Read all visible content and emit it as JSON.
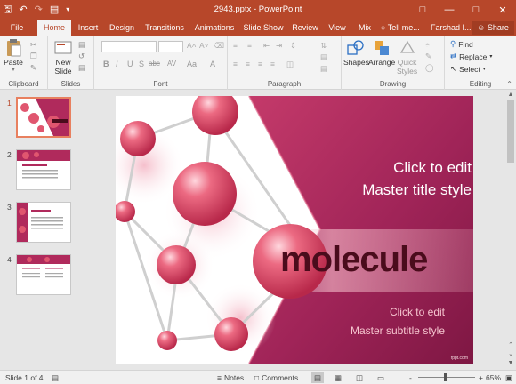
{
  "titlebar": {
    "doc_title": "2943.pptx - PowerPoint",
    "qat": [
      "save-icon",
      "undo-icon",
      "redo-icon",
      "start-icon",
      "customize-icon"
    ]
  },
  "tabs": [
    "File",
    "Home",
    "Insert",
    "Design",
    "Transitions",
    "Animations",
    "Slide Show",
    "Review",
    "View",
    "Mix"
  ],
  "active_tab": "Home",
  "tell_me": "Tell me...",
  "user": "Farshad I...",
  "share": "Share",
  "ribbon": {
    "clipboard": {
      "paste": "Paste",
      "label": "Clipboard"
    },
    "slides": {
      "new_slide": "New",
      "new_slide2": "Slide",
      "label": "Slides"
    },
    "font": {
      "label": "Font",
      "bold": "B",
      "italic": "I",
      "underline": "U",
      "strike": "S",
      "shadow": "abc",
      "spacing": "AV",
      "case": "Aa",
      "color": "A"
    },
    "paragraph": {
      "label": "Paragraph"
    },
    "drawing": {
      "shapes": "Shapes",
      "arrange": "Arrange",
      "quick": "Quick",
      "styles": "Styles",
      "label": "Drawing"
    },
    "editing": {
      "find": "Find",
      "replace": "Replace",
      "select": "Select",
      "label": "Editing"
    }
  },
  "thumbnails": [
    "1",
    "2",
    "3",
    "4"
  ],
  "slide": {
    "title_line1": "Click to edit",
    "title_line2": "Master title style",
    "subtitle_line1": "Click to edit",
    "subtitle_line2": "Master subtitle style",
    "word": "molecule",
    "footer": "fppt.com"
  },
  "status": {
    "slide_of": "Slide 1 of 4",
    "notes": "Notes",
    "comments": "Comments",
    "zoom_minus": "-",
    "zoom_plus": "+",
    "zoom_level": "65%"
  },
  "colors": {
    "accent": "#b7472a",
    "slide_magenta": "#b02a5c",
    "sphere": "#e0566f"
  }
}
